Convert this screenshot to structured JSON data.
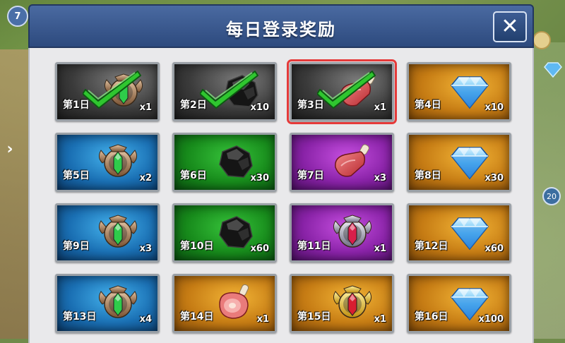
{
  "background": {
    "level_badge": "7",
    "right_badge": "20",
    "left_arrow": "›"
  },
  "dialog": {
    "title": "每日登录奖励",
    "close_label": "✕"
  },
  "colors": {
    "header": "#2d4a7e",
    "check": "#2fc62f",
    "selected_border": "#e53a3a"
  },
  "rewards": [
    {
      "day": "第1日",
      "qty": "x1",
      "item": "emblem-green-icon",
      "tile": "dark",
      "claimed": true,
      "selected": false
    },
    {
      "day": "第2日",
      "qty": "x10",
      "item": "coal-icon",
      "tile": "dark",
      "claimed": true,
      "selected": false
    },
    {
      "day": "第3日",
      "qty": "x1",
      "item": "meat-icon",
      "tile": "dark",
      "claimed": true,
      "selected": true
    },
    {
      "day": "第4日",
      "qty": "x10",
      "item": "diamond-icon",
      "tile": "gold",
      "claimed": false,
      "selected": false
    },
    {
      "day": "第5日",
      "qty": "x2",
      "item": "emblem-green-icon",
      "tile": "blue",
      "claimed": false,
      "selected": false
    },
    {
      "day": "第6日",
      "qty": "x30",
      "item": "coal-icon",
      "tile": "green",
      "claimed": false,
      "selected": false
    },
    {
      "day": "第7日",
      "qty": "x3",
      "item": "meat-icon",
      "tile": "purple",
      "claimed": false,
      "selected": false
    },
    {
      "day": "第8日",
      "qty": "x30",
      "item": "diamond-icon",
      "tile": "gold",
      "claimed": false,
      "selected": false
    },
    {
      "day": "第9日",
      "qty": "x3",
      "item": "emblem-green-icon",
      "tile": "blue",
      "claimed": false,
      "selected": false
    },
    {
      "day": "第10日",
      "qty": "x60",
      "item": "coal-icon",
      "tile": "green",
      "claimed": false,
      "selected": false
    },
    {
      "day": "第11日",
      "qty": "x1",
      "item": "emblem-silver-icon",
      "tile": "purple",
      "claimed": false,
      "selected": false
    },
    {
      "day": "第12日",
      "qty": "x60",
      "item": "diamond-icon",
      "tile": "gold",
      "claimed": false,
      "selected": false
    },
    {
      "day": "第13日",
      "qty": "x4",
      "item": "emblem-green-icon",
      "tile": "blue",
      "claimed": false,
      "selected": false
    },
    {
      "day": "第14日",
      "qty": "x1",
      "item": "ham-icon",
      "tile": "gold",
      "claimed": false,
      "selected": false
    },
    {
      "day": "第15日",
      "qty": "x1",
      "item": "emblem-gold-icon",
      "tile": "gold",
      "claimed": false,
      "selected": false
    },
    {
      "day": "第16日",
      "qty": "x100",
      "item": "diamond-icon",
      "tile": "gold",
      "claimed": false,
      "selected": false
    }
  ]
}
